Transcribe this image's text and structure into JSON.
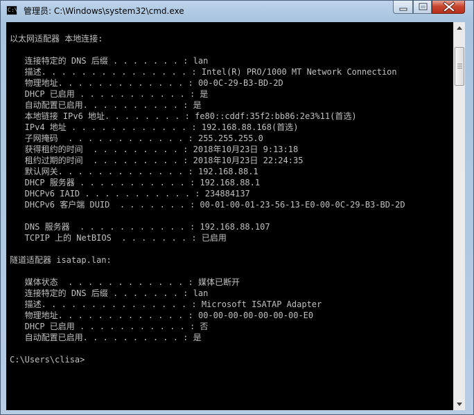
{
  "window": {
    "title": "管理员: C:\\Windows\\system32\\cmd.exe",
    "icon_text": "C:\\",
    "icons": {
      "app": "cmd-app-icon",
      "minimize": "minimize-icon",
      "maximize": "maximize-icon",
      "close": "close-icon"
    }
  },
  "console": {
    "lines": [
      "以太网适配器 本地连接:",
      "",
      "   连接特定的 DNS 后缀 . . . . . . . : lan",
      "   描述. . . . . . . . . . . . . . . : Intel(R) PRO/1000 MT Network Connection",
      "   物理地址. . . . . . . . . . . . . : 00-0C-29-B3-BD-2D",
      "   DHCP 已启用 . . . . . . . . . . . : 是",
      "   自动配置已启用. . . . . . . . . . : 是",
      "   本地链接 IPv6 地址. . . . . . . . : fe80::cddf:35f2:bb86:2e3%11(首选)",
      "   IPv4 地址 . . . . . . . . . . . . : 192.168.88.168(首选)",
      "   子网掩码  . . . . . . . . . . . . : 255.255.255.0",
      "   获得租约的时间  . . . . . . . . . : 2018年10月23日 9:13:18",
      "   租约过期的时间  . . . . . . . . . : 2018年10月23日 22:24:35",
      "   默认网关. . . . . . . . . . . . . : 192.168.88.1",
      "   DHCP 服务器 . . . . . . . . . . . : 192.168.88.1",
      "   DHCPv6 IAID . . . . . . . . . . . : 234884137",
      "   DHCPv6 客户端 DUID  . . . . . . . : 00-01-00-01-23-56-13-E0-00-0C-29-B3-BD-2D",
      "",
      "   DNS 服务器  . . . . . . . . . . . : 192.168.88.107",
      "   TCPIP 上的 NetBIOS  . . . . . . . : 已启用",
      "",
      "隧道适配器 isatap.lan:",
      "",
      "   媒体状态  . . . . . . . . . . . . : 媒体已断开",
      "   连接特定的 DNS 后缀 . . . . . . . : lan",
      "   描述. . . . . . . . . . . . . . . : Microsoft ISATAP Adapter",
      "   物理地址. . . . . . . . . . . . . : 00-00-00-00-00-00-00-E0",
      "   DHCP 已启用 . . . . . . . . . . . : 否",
      "   自动配置已启用. . . . . . . . . . : 是",
      "",
      "C:\\Users\\clisa>"
    ]
  },
  "scrollbar": {
    "up_icon": "scroll-up-arrow-icon",
    "down_icon": "scroll-down-arrow-icon"
  }
}
